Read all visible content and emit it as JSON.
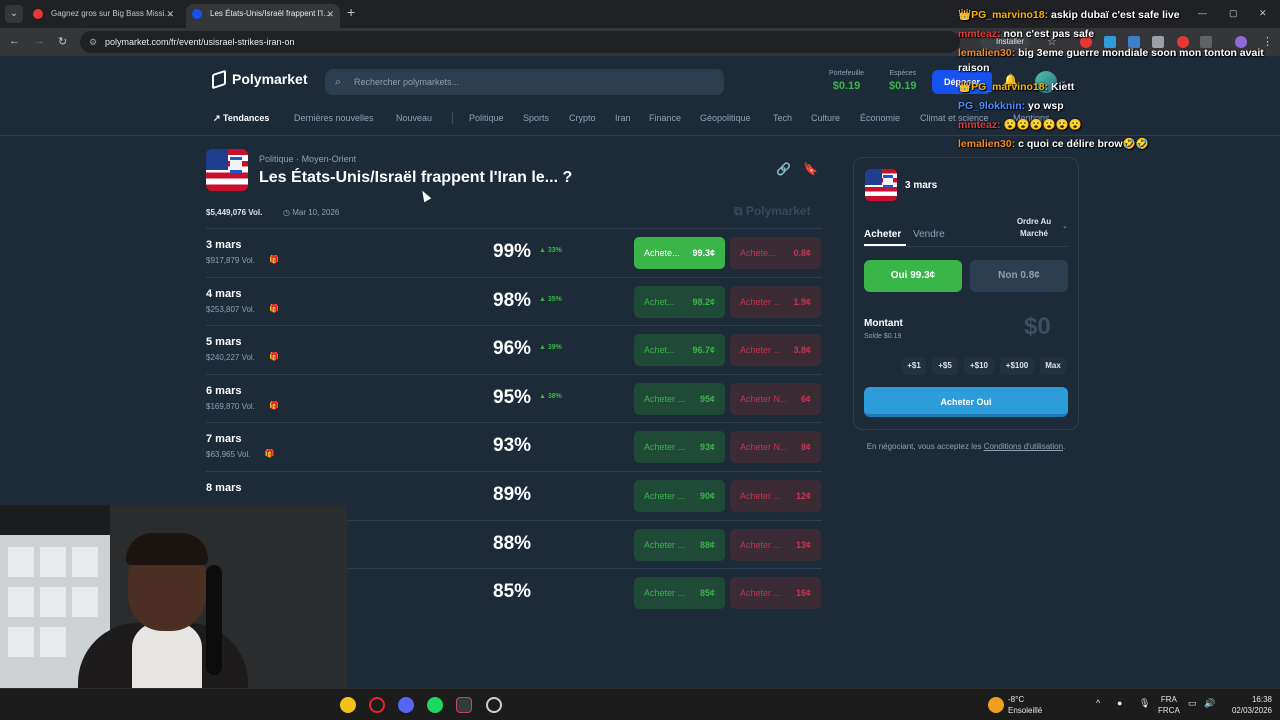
{
  "browser": {
    "tabs": [
      {
        "title": "Gagnez gros sur Big Bass Missi…"
      },
      {
        "title": "Les États-Unis/Israël frappent l'I…"
      }
    ],
    "url": "polymarket.com/fr/event/usisrael-strikes-iran-on",
    "install_label": "Installer"
  },
  "header": {
    "logo": "Polymarket",
    "search_placeholder": "Rechercher polymarkets...",
    "portfolio_label": "Portefeuille",
    "portfolio_value": "$0.19",
    "cash_label": "Espèces",
    "cash_value": "$0.19",
    "deposit_label": "Déposer"
  },
  "categories": [
    "Tendances",
    "Dernières nouvelles",
    "Nouveau",
    "Politique",
    "Sports",
    "Crypto",
    "Iran",
    "Finance",
    "Géopolitique",
    "Tech",
    "Culture",
    "Économie",
    "Climat et science",
    "Mentions"
  ],
  "event": {
    "crumb_1": "Politique",
    "crumb_sep": "·",
    "crumb_2": "Moyen-Orient",
    "title": "Les États-Unis/Israël frappent l'Iran le... ?",
    "volume": "$5,449,076 Vol.",
    "date": "Mar 10, 2026",
    "watermark": "Polymarket"
  },
  "markets": [
    {
      "label": "3 mars",
      "vol": "$917,879 Vol.",
      "pct": "99%",
      "change": "33%",
      "yes": "Achete...",
      "yes_price": "99.3¢",
      "no": "Achete...",
      "no_price": "0.8¢"
    },
    {
      "label": "4 mars",
      "vol": "$253,807 Vol.",
      "pct": "98%",
      "change": "35%",
      "yes": "Achet...",
      "yes_price": "98.2¢",
      "no": "Acheter ...",
      "no_price": "1.9¢"
    },
    {
      "label": "5 mars",
      "vol": "$240,227 Vol.",
      "pct": "96%",
      "change": "39%",
      "yes": "Achet...",
      "yes_price": "96.7¢",
      "no": "Acheter ...",
      "no_price": "3.8¢"
    },
    {
      "label": "6 mars",
      "vol": "$169,870 Vol.",
      "pct": "95%",
      "change": "38%",
      "yes": "Acheter ...",
      "yes_price": "95¢",
      "no": "Acheter N...",
      "no_price": "6¢"
    },
    {
      "label": "7 mars",
      "vol": "$63,965 Vol.",
      "pct": "93%",
      "change": "",
      "yes": "Acheter ...",
      "yes_price": "93¢",
      "no": "Acheter N...",
      "no_price": "8¢"
    },
    {
      "label": "8 mars",
      "vol": "",
      "pct": "89%",
      "change": "",
      "yes": "Acheter ...",
      "yes_price": "90¢",
      "no": "Acheter ...",
      "no_price": "12¢"
    },
    {
      "label": "",
      "vol": "",
      "pct": "88%",
      "change": "",
      "yes": "Acheter ...",
      "yes_price": "88¢",
      "no": "Acheter ...",
      "no_price": "13¢"
    },
    {
      "label": "",
      "vol": "",
      "pct": "85%",
      "change": "",
      "yes": "Acheter ...",
      "yes_price": "85¢",
      "no": "Acheter ...",
      "no_price": "16¢"
    }
  ],
  "panel": {
    "title": "3 mars",
    "tab_buy": "Acheter",
    "tab_sell": "Vendre",
    "order_type": "Ordre Au Marché",
    "yes_btn": "Oui 99.3¢",
    "no_btn": "Non 0.8¢",
    "amount_label": "Montant",
    "balance": "Solde $0.19",
    "amount_value": "$0",
    "quick": [
      "+$1",
      "+$5",
      "+$10",
      "+$100",
      "Max"
    ],
    "buy_btn": "Acheter Oui"
  },
  "terms": {
    "text": "En négociant, vous acceptez les",
    "link": "Conditions d'utilisation",
    "end": "."
  },
  "chat": [
    {
      "user": "👑PG_marvino18:",
      "msg": "askip dubaï c'est safe live",
      "color": "#f5b400"
    },
    {
      "user": "mmteaz:",
      "msg": "non c'est pas safe",
      "color": "#e03a3a"
    },
    {
      "user": "lemalien30:",
      "msg": "big 3eme guerre mondiale soon mon tonton avait raison",
      "color": "#f08a2c"
    },
    {
      "user": "👑PG_marvino18:",
      "msg": "Kiett",
      "color": "#f5b400"
    },
    {
      "user": "PG_9lokknin:",
      "msg": "yo wsp",
      "color": "#4a8cff"
    },
    {
      "user": "mmteaz:",
      "msg": "😮😮😮😮😮😮",
      "color": "#e03a3a"
    },
    {
      "user": "lemalien30:",
      "msg": "c quoi ce délire brow🤣🤣",
      "color": "#f08a2c"
    }
  ],
  "taskbar": {
    "temp": "-8°C",
    "weather": "Ensoleillé",
    "lang_1": "FRA",
    "lang_2": "FRCA",
    "time": "16:38",
    "date": "02/03/2026"
  }
}
